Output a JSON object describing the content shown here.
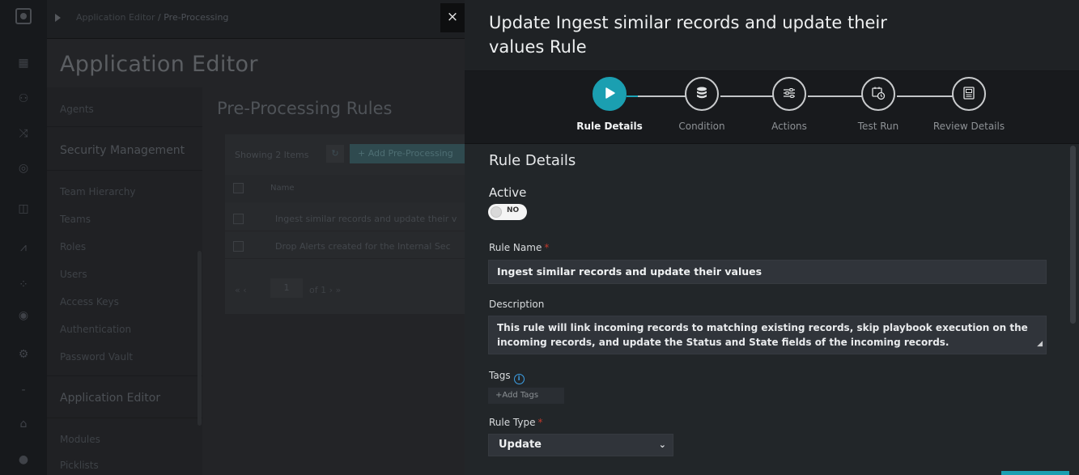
{
  "breadcrumb": {
    "part1": "Application Editor",
    "sep": " / ",
    "part2": "Pre-Processing"
  },
  "background": {
    "title": "Application Editor",
    "sidenav": {
      "agents": "Agents",
      "security_heading": "Security Management",
      "items": [
        "Team Hierarchy",
        "Teams",
        "Roles",
        "Users",
        "Access Keys",
        "Authentication",
        "Password Vault"
      ],
      "app_heading": "Application Editor",
      "items2": [
        "Modules",
        "Picklists"
      ]
    },
    "section_title": "Pre-Processing Rules",
    "showing": "Showing  2 Items",
    "add_button": "+  Add Pre-Processing",
    "col_name": "Name",
    "rows": [
      "Ingest similar records and update their v",
      "Drop Alerts created for the Internal Sec"
    ],
    "pager": {
      "nav_left": "«  ‹",
      "page": "1",
      "of": "of  1  ›  »"
    }
  },
  "close_glyph": "×",
  "drawer": {
    "title": "Update Ingest similar records and update their values Rule",
    "steps": [
      {
        "label": "Rule Details",
        "icon": "play-icon"
      },
      {
        "label": "Condition",
        "icon": "database-icon"
      },
      {
        "label": "Actions",
        "icon": "sliders-icon"
      },
      {
        "label": "Test Run",
        "icon": "calendar-clock-icon"
      },
      {
        "label": "Review Details",
        "icon": "review-icon"
      }
    ],
    "section_title": "Rule Details",
    "active_label": "Active",
    "toggle_text": "NO",
    "rule_name_label": "Rule Name",
    "rule_name_value": "Ingest similar records and update their values",
    "description_label": "Description",
    "description_value": "This rule will link incoming records to matching existing records, skip playbook execution on the incoming records, and update the Status and State fields of the incoming records.",
    "tags_label": "Tags",
    "tags_placeholder": "+Add Tags",
    "rule_type_label": "Rule Type",
    "rule_type_value": "Update",
    "required_mark": "*"
  },
  "colors": {
    "accent": "#1b9fb1",
    "required": "#c0392b",
    "info": "#3da2ea"
  }
}
